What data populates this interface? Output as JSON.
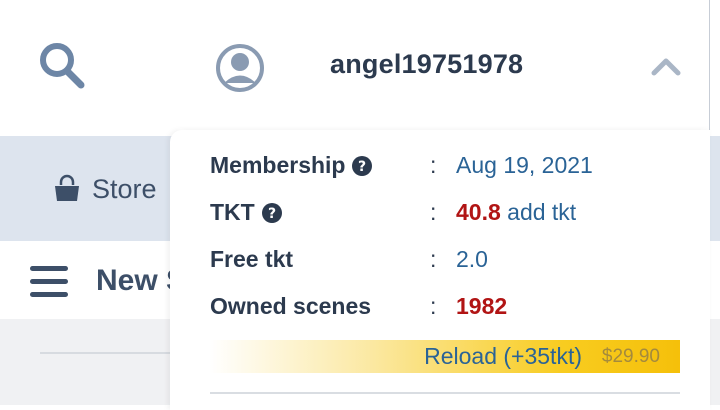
{
  "header": {
    "username": "angel19751978"
  },
  "nav": {
    "store_label": "Store",
    "new_label": "New S"
  },
  "account_menu": {
    "membership": {
      "label": "Membership",
      "separator": ":",
      "value": "Aug 19, 2021"
    },
    "tkt": {
      "label": "TKT",
      "separator": ":",
      "amount": "40.8",
      "add_link": "add tkt"
    },
    "free_tkt": {
      "label": "Free tkt",
      "separator": ":",
      "value": "2.0"
    },
    "owned_scenes": {
      "label": "Owned scenes",
      "separator": ":",
      "value": "1982"
    },
    "reload": {
      "label": "Reload (+35tkt)",
      "price": "$29.90"
    }
  },
  "icons": {
    "search": "search-icon",
    "avatar": "user-avatar-icon",
    "collapse": "chevron-up-icon",
    "store": "shopping-bag-icon",
    "menu": "hamburger-menu-icon",
    "help": "question-circle-icon"
  },
  "colors": {
    "text_dark": "#2c3a4e",
    "link_blue": "#2a6396",
    "value_red": "#b11414",
    "store_band": "#dde4ee",
    "reload_gold": "#f5c00a"
  }
}
